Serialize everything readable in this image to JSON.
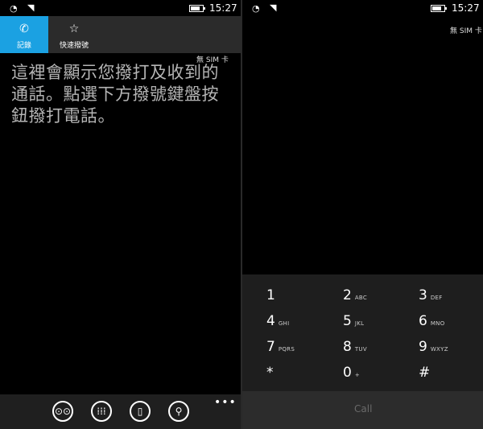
{
  "left": {
    "status": {
      "time": "15:27",
      "battery_level": 0.7
    },
    "tabs": [
      {
        "label": "記錄",
        "icon": "phone-icon",
        "active": true
      },
      {
        "label": "快速撥號",
        "icon": "star-icon",
        "active": false
      }
    ],
    "sim_text": "無 SIM 卡",
    "message": "這裡會顯示您撥打及收到的通話。點選下方撥號鍵盤按鈕撥打電話。",
    "app_bar": [
      {
        "icon": "voicemail-icon"
      },
      {
        "icon": "keypad-icon"
      },
      {
        "icon": "contacts-icon"
      },
      {
        "icon": "search-icon"
      }
    ],
    "more": "•••"
  },
  "right": {
    "status": {
      "time": "15:27",
      "battery_level": 0.7
    },
    "sim_text": "無 SIM 卡",
    "keys": [
      {
        "digit": "1",
        "letters": ""
      },
      {
        "digit": "2",
        "letters": "ABC"
      },
      {
        "digit": "3",
        "letters": "DEF"
      },
      {
        "digit": "4",
        "letters": "GHI"
      },
      {
        "digit": "5",
        "letters": "JKL"
      },
      {
        "digit": "6",
        "letters": "MNO"
      },
      {
        "digit": "7",
        "letters": "PQRS"
      },
      {
        "digit": "8",
        "letters": "TUV"
      },
      {
        "digit": "9",
        "letters": "WXYZ"
      },
      {
        "digit": "*",
        "letters": ""
      },
      {
        "digit": "0",
        "letters": "+"
      },
      {
        "digit": "#",
        "letters": ""
      }
    ],
    "call_label": "Call"
  },
  "colors": {
    "accent": "#1ba1e2",
    "background": "#000000",
    "pivot_bg": "#2b2b2b",
    "dialpad_bg": "#1e1e1e"
  }
}
